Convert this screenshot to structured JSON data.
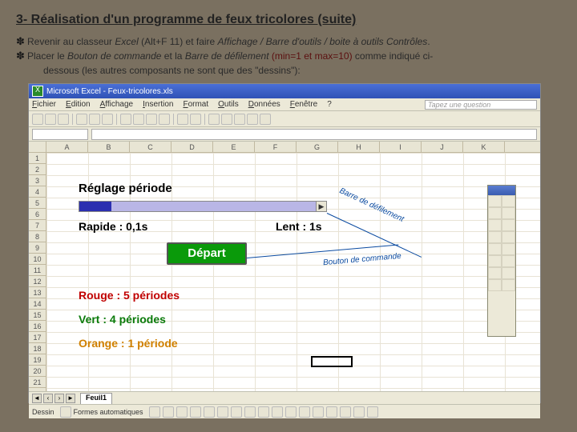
{
  "heading": "3- Réalisation d'un programme de feux tricolores (suite)",
  "bullets": {
    "revenir_pre": "Revenir au classeur ",
    "excel": "Excel",
    "revenir_mid": " (Alt+F 11) et faire ",
    "menu_path": "Affichage / Barre d'outils / boite à outils Contrôles",
    "revenir_end": ".",
    "placer_pre": "Placer le ",
    "bouton": "Bouton de commande",
    "placer_mid": " et la ",
    "barre": "Barre de défilement",
    "placer_spec": "  (min=1 et max=10)",
    "placer_post": " comme indiqué ci-",
    "placer_cont": "dessous (les autres composants ne sont que des \"dessins\"):"
  },
  "excel": {
    "title": "Microsoft Excel - Feux-tricolores.xls",
    "menus": [
      "Fichier",
      "Edition",
      "Affichage",
      "Insertion",
      "Format",
      "Outils",
      "Données",
      "Fenêtre",
      "?"
    ],
    "question_placeholder": "Tapez une question",
    "columns": [
      "A",
      "B",
      "C",
      "D",
      "E",
      "F",
      "G",
      "H",
      "I",
      "J",
      "K"
    ],
    "rows": [
      "1",
      "2",
      "3",
      "4",
      "5",
      "6",
      "7",
      "8",
      "9",
      "10",
      "11",
      "12",
      "13",
      "14",
      "15",
      "16",
      "17",
      "18",
      "19",
      "20",
      "21"
    ],
    "reglage": "Réglage période",
    "rapide": "Rapide : 0,1s",
    "lent": "Lent : 1s",
    "depart": "Départ",
    "rouge_label": "Rouge  : 5 périodes",
    "vert_label": "Vert     : 4 périodes",
    "orange_label": "Orange : 1 période",
    "anno_barre": "Barre de défilement",
    "anno_bouton": "Bouton de commande",
    "sheet_tab": "Feuil1",
    "draw_label": "Dessin",
    "shapes_label": "Formes automatiques"
  }
}
